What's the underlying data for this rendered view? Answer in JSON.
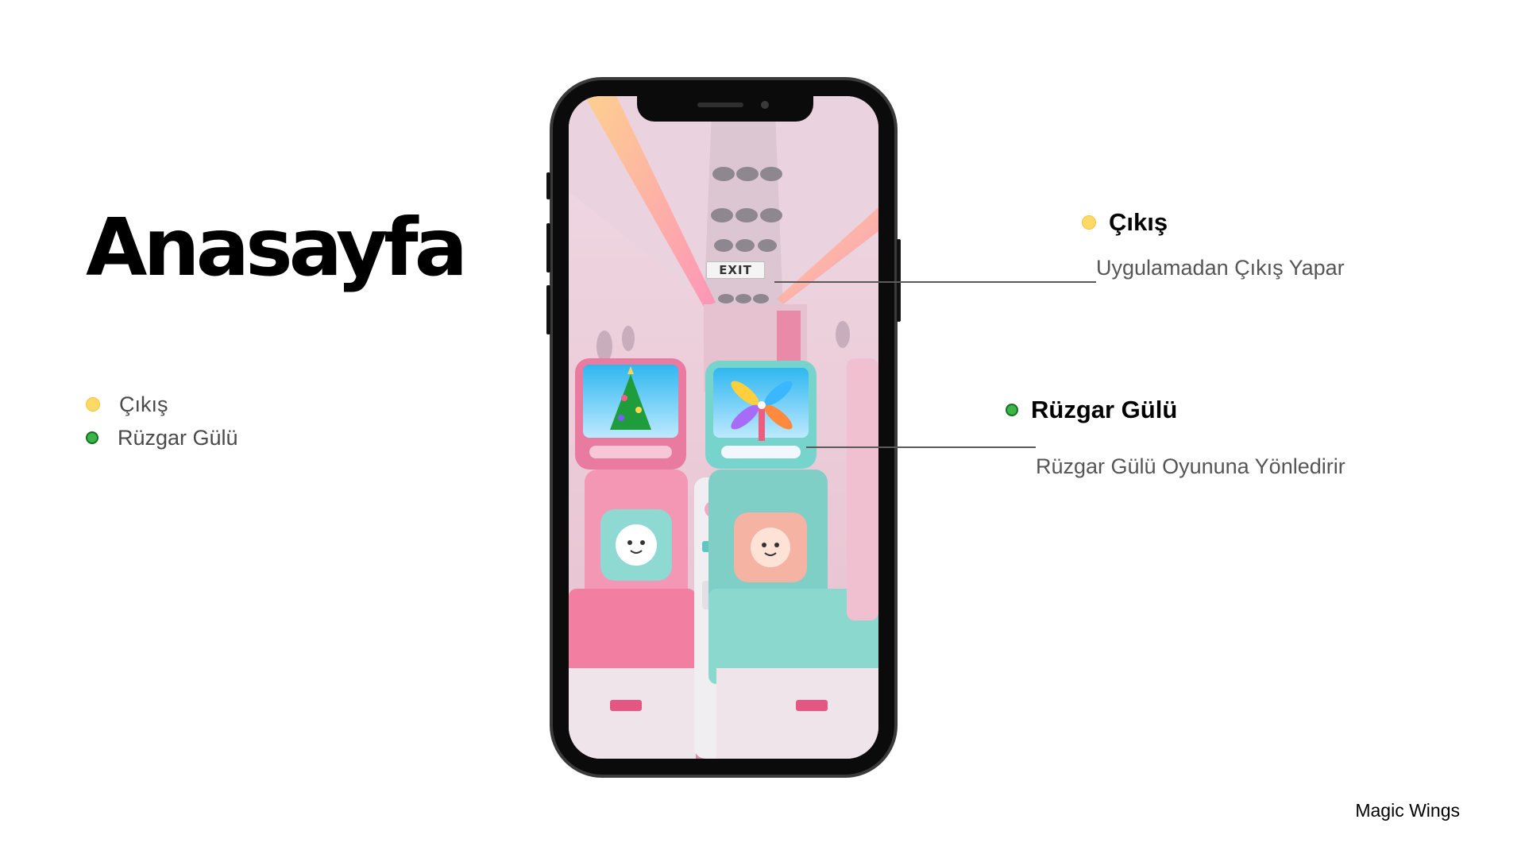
{
  "page": {
    "title": "Anasayfa",
    "brand": "Magic Wings"
  },
  "legend": [
    {
      "label": "Çıkış",
      "color": "#FFD966"
    },
    {
      "label": "Rüzgar Gülü",
      "color": "#39B54A"
    }
  ],
  "phone_screen": {
    "exit_sign": "EXIT"
  },
  "callouts": {
    "exit": {
      "title": "Çıkış",
      "description": "Uygulamadan Çıkış Yapar"
    },
    "windrose": {
      "title": "Rüzgar Gülü",
      "description": "Rüzgar Gülü Oyununa Yönledirir"
    }
  }
}
